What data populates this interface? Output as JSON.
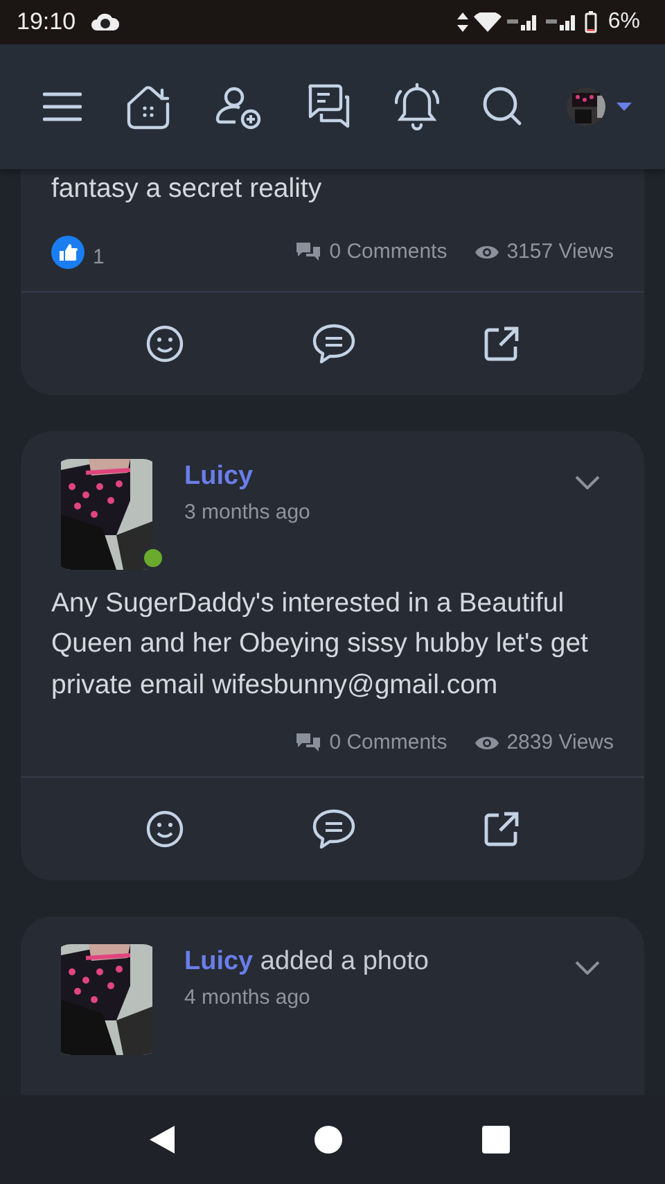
{
  "status_bar": {
    "time": "19:10",
    "battery": "6%"
  },
  "posts": [
    {
      "text": "fantasy a secret reality",
      "likes": "1",
      "comments": "0 Comments",
      "views": "3157 Views"
    },
    {
      "author": "Luicy",
      "time": "3 months ago",
      "online": true,
      "text": "Any SugerDaddy's interested in a Beautiful Queen and her Obeying sissy hubby let's get private email wifesbunny@gmail.com",
      "comments": "0 Comments",
      "views": "2839 Views"
    },
    {
      "author": "Luicy",
      "action": "added a photo",
      "time": "4 months ago"
    }
  ]
}
